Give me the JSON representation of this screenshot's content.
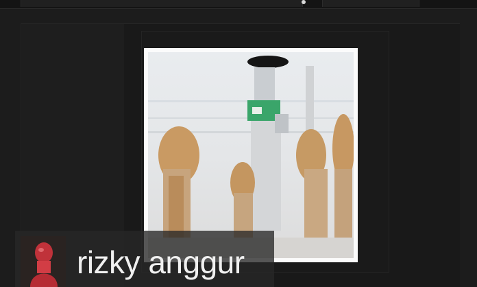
{
  "user_tag": {
    "username": "rizky anggur"
  },
  "icons": {
    "avatar": "user-avatar-icon"
  },
  "colors": {
    "background": "#1c1c1c",
    "text": "#f0f0f0",
    "avatar_accent": "#c0323a",
    "photo_green": "#3aa56a"
  }
}
